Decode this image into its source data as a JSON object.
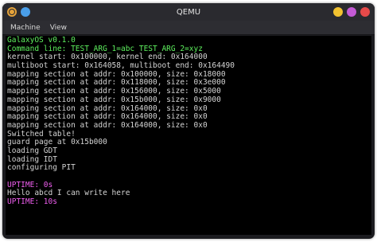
{
  "window": {
    "title": "QEMU"
  },
  "menu": {
    "items": [
      "Machine",
      "View"
    ]
  },
  "colors": {
    "green": "#5ef05e",
    "magenta": "#f05ef0",
    "white": "#d4d4d4"
  },
  "console": {
    "lines": [
      {
        "text": "GalaxyOS v0.1.0",
        "color": "green"
      },
      {
        "text": "Command line: TEST_ARG_1=abc TEST_ARG_2=xyz",
        "color": "green"
      },
      {
        "text": "kernel start: 0x100000, kernel end: 0x164000",
        "color": "white"
      },
      {
        "text": "multiboot start: 0x164058, multiboot end: 0x164490",
        "color": "white"
      },
      {
        "text": "mapping section at addr: 0x100000, size: 0x18000",
        "color": "white"
      },
      {
        "text": "mapping section at addr: 0x118000, size: 0x3e000",
        "color": "white"
      },
      {
        "text": "mapping section at addr: 0x156000, size: 0x5000",
        "color": "white"
      },
      {
        "text": "mapping section at addr: 0x15b000, size: 0x9000",
        "color": "white"
      },
      {
        "text": "mapping section at addr: 0x164000, size: 0x0",
        "color": "white"
      },
      {
        "text": "mapping section at addr: 0x164000, size: 0x0",
        "color": "white"
      },
      {
        "text": "mapping section at addr: 0x164000, size: 0x0",
        "color": "white"
      },
      {
        "text": "Switched table!",
        "color": "white"
      },
      {
        "text": "guard page at 0x15b000",
        "color": "white"
      },
      {
        "text": "loading GDT",
        "color": "white"
      },
      {
        "text": "loading IDT",
        "color": "white"
      },
      {
        "text": "configuring PIT",
        "color": "white"
      },
      {
        "text": "",
        "color": "white"
      },
      {
        "text": "UPTIME: 0s",
        "color": "magenta"
      },
      {
        "text": "Hello abcd I can write here",
        "color": "white"
      },
      {
        "text": "UPTIME: 10s",
        "color": "magenta"
      }
    ]
  }
}
